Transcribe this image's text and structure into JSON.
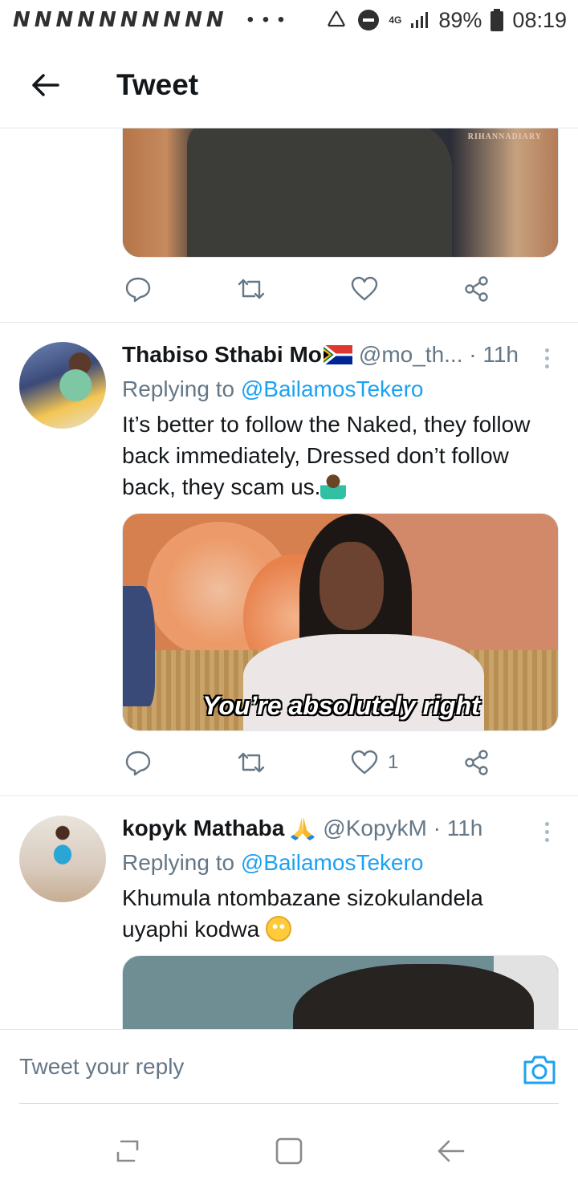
{
  "status_bar": {
    "left_icons": [
      "N",
      "N",
      "N",
      "N",
      "N",
      "N",
      "N",
      "N",
      "N",
      "N"
    ],
    "overflow": "• • •",
    "network": "4G",
    "battery_percent": "89%",
    "time": "08:19"
  },
  "header": {
    "title": "Tweet"
  },
  "prev_media": {
    "watermark": "RIHANNADIARY"
  },
  "tweets": [
    {
      "display_name": "Thabiso Sthabi Mo",
      "handle_time": "@mo_th... · 11h",
      "replying_prefix": "Replying to",
      "replying_to": "@BailamosTekero",
      "text": "It’s better to follow the Naked, they follow back immediately, Dressed don’t follow back, they scam us.",
      "media_caption": "You’re absolutely right",
      "like_count": "1"
    },
    {
      "display_name": "kopyk Mathaba",
      "handle_time": "@KopykM · 11h",
      "replying_prefix": "Replying to",
      "replying_to": "@BailamosTekero",
      "text": "Khumula ntombazane sizokulandela uyaphi kodwa"
    }
  ],
  "reply_bar": {
    "placeholder": "Tweet your reply"
  },
  "colors": {
    "accent": "#1da1f2",
    "secondary_text": "#657786",
    "primary_text": "#14171a",
    "divider": "#e1e8ed"
  },
  "icons": [
    "back-arrow-icon",
    "reply-icon",
    "retweet-icon",
    "like-icon",
    "share-icon",
    "more-icon",
    "camera-icon",
    "recents-icon",
    "home-icon",
    "nav-back-icon"
  ]
}
